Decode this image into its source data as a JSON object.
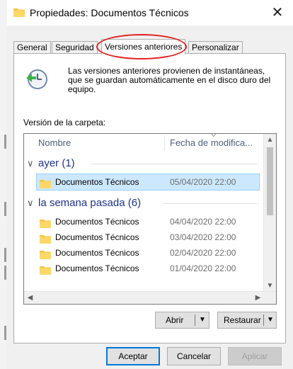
{
  "window": {
    "title": "Propiedades: Documentos Técnicos",
    "close_glyph": "✕"
  },
  "tabs": [
    {
      "label": "General",
      "selected": false
    },
    {
      "label": "Seguridad",
      "selected": false
    },
    {
      "label": "Versiones anteriores",
      "selected": true
    },
    {
      "label": "Personalizar",
      "selected": false
    }
  ],
  "highlight_color": "#e02020",
  "panel": {
    "icon": "clock-restore-icon",
    "description": "Las versiones anteriores provienen de instantáneas, que se guardan automáticamente en el disco duro del equipo.",
    "section_label": "Versión de la carpeta:"
  },
  "list": {
    "columns": {
      "name": "Nombre",
      "date": "Fecha de modifica..."
    },
    "groups": [
      {
        "label": "ayer (1)",
        "rows": [
          {
            "name": "Documentos Técnicos",
            "date": "05/04/2020 22:00",
            "selected": true
          }
        ]
      },
      {
        "label": "la semana pasada (6)",
        "rows": [
          {
            "name": "Documentos Técnicos",
            "date": "04/04/2020 22:00",
            "selected": false
          },
          {
            "name": "Documentos Técnicos",
            "date": "03/04/2020 22:00",
            "selected": false
          },
          {
            "name": "Documentos Técnicos",
            "date": "02/04/2020 22:00",
            "selected": false
          },
          {
            "name": "Documentos Técnicos",
            "date": "01/04/2020 22:00",
            "selected": false
          }
        ]
      }
    ]
  },
  "actions": {
    "open": "Abrir",
    "restore": "Restaurar"
  },
  "buttons": {
    "accept": "Aceptar",
    "cancel": "Cancelar",
    "apply": "Aplicar"
  }
}
